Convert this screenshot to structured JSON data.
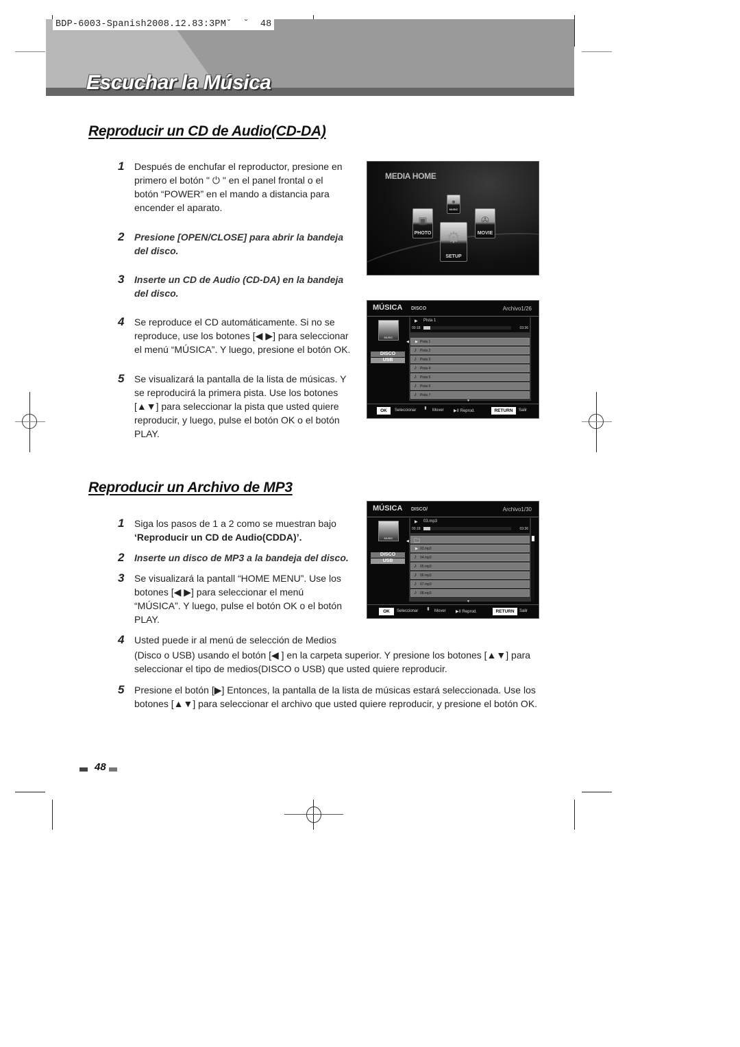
{
  "slug": "BDP-6003-Spanish2008.12.83:3PM˘  ˘  48",
  "page_title": "Escuchar la Música",
  "section1": {
    "title": "Reproducir un CD de Audio(CD-DA)",
    "steps": [
      {
        "num": "1",
        "lines": [
          "Después de enchufar el reproductor, presione en",
          "primero el botón \" ⏻ \" en el panel frontal o el",
          "botón “POWER” en el mando a distancia para",
          "encender el aparato."
        ]
      },
      {
        "num": "2",
        "lines": [
          "Presione [OPEN/CLOSE] para abrir la bandeja",
          "del disco."
        ]
      },
      {
        "num": "3",
        "lines": [
          "Inserte un CD de Audio (CD-DA) en la bandeja",
          "del disco."
        ]
      },
      {
        "num": "4",
        "lines": [
          "Se reproduce el CD automáticamente. Si no se",
          "reproduce, use los botones [◀ ▶] para seleccionar",
          "el menú “MÚSICA”. Y luego, presione el botón OK."
        ]
      },
      {
        "num": "5",
        "lines": [
          "Se visualizará la pantalla de la lista de músicas. Y",
          "se reproducirá la primera pista. Use los botones",
          "[▲▼] para seleccionar la pista que usted quiere",
          "reproducir, y luego, pulse el botón OK o el botón",
          "PLAY."
        ]
      }
    ]
  },
  "section2": {
    "title": "Reproducir un Archivo de MP3",
    "steps": [
      {
        "num": "1",
        "lines": [
          "Siga los pasos de 1 a 2 como se muestran bajo",
          "‘Reproducir un CD de Audio(CDDA)’."
        ]
      },
      {
        "num": "2",
        "lines": [
          "Inserte un disco de MP3 a la bandeja del disco."
        ]
      },
      {
        "num": "3",
        "lines": [
          "Se visualizará la pantall “HOME MENU”. Use los",
          "botones [◀ ▶] para seleccionar el menú",
          "“MÚSICA”. Y luego, pulse el botón OK o el botón",
          "PLAY."
        ]
      },
      {
        "num": "4",
        "lines": [
          "Usted puede ir al menú de selección de Medios",
          "(Disco o USB) usando el botón [◀ ] en la carpeta superior. Y presione los botones [▲▼] para",
          "seleccionar el tipo de medios(DISCO o USB) que usted quiere reproducir."
        ]
      },
      {
        "num": "5",
        "lines": [
          "Presione el botón [▶] Entonces, la pantalla de la lista de músicas estará seleccionada. Use los",
          "botones  [▲▼] para seleccionar el archivo que usted quiere reproducir, y presione el botón OK."
        ]
      }
    ]
  },
  "media_home": {
    "title": "MEDIA HOME",
    "tiles": {
      "music": "MUSIC",
      "photo": "PHOTO",
      "movie": "MOVIE",
      "setup": "SETUP"
    }
  },
  "screen_cd": {
    "title": "MÚSICA",
    "path": "DISCO",
    "counter": "Archivo1/26",
    "side_icon": "MUSIC",
    "media": [
      "DISCO",
      "USB"
    ],
    "now_playing": {
      "title": "Pista 1",
      "elapsed": "00:18",
      "total": "03:36",
      "progress": 0.08
    },
    "items": [
      "Pista 1",
      "Pista 2",
      "Pista 3",
      "Pista 4",
      "Pista 5",
      "Pista 6",
      "Pista 7"
    ],
    "footer": {
      "ok": "OK",
      "select": "Seleccionar",
      "move": "Mover",
      "play": "▶II Reprod.",
      "return": "RETURN",
      "exit": "Salir"
    }
  },
  "screen_mp3": {
    "title": "MÚSICA",
    "path": "DISCO/",
    "counter": "Archivo1/30",
    "side_icon": "MUSIC",
    "media": [
      "DISCO",
      "USB"
    ],
    "now_playing": {
      "title": "03.mp3",
      "elapsed": "00:18",
      "total": "03:36",
      "progress": 0.08
    },
    "items": [
      "",
      "03.mp3",
      "04.mp3",
      "05.mp3",
      "06.mp3",
      "07.mp3",
      "08.mp3"
    ],
    "footer": {
      "ok": "OK",
      "select": "Seleccionar",
      "move": "Mover",
      "play": "▶II Reprod.",
      "return": "RETURN",
      "exit": "Salir"
    }
  },
  "page_number": "48"
}
